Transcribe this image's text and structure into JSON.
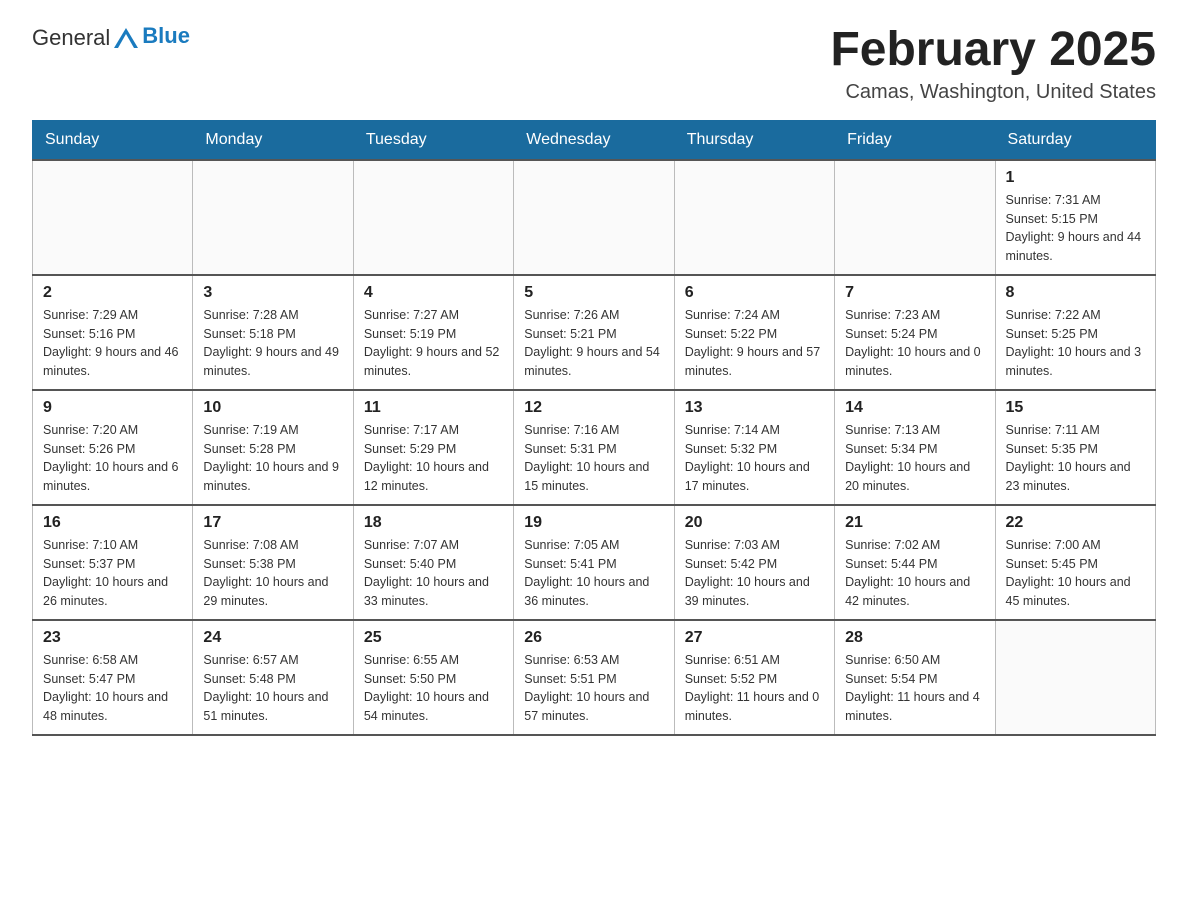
{
  "header": {
    "logo_general": "General",
    "logo_blue": "Blue",
    "month_year": "February 2025",
    "location": "Camas, Washington, United States"
  },
  "days_of_week": [
    "Sunday",
    "Monday",
    "Tuesday",
    "Wednesday",
    "Thursday",
    "Friday",
    "Saturday"
  ],
  "weeks": [
    [
      {
        "day": "",
        "info": ""
      },
      {
        "day": "",
        "info": ""
      },
      {
        "day": "",
        "info": ""
      },
      {
        "day": "",
        "info": ""
      },
      {
        "day": "",
        "info": ""
      },
      {
        "day": "",
        "info": ""
      },
      {
        "day": "1",
        "info": "Sunrise: 7:31 AM\nSunset: 5:15 PM\nDaylight: 9 hours and 44 minutes."
      }
    ],
    [
      {
        "day": "2",
        "info": "Sunrise: 7:29 AM\nSunset: 5:16 PM\nDaylight: 9 hours and 46 minutes."
      },
      {
        "day": "3",
        "info": "Sunrise: 7:28 AM\nSunset: 5:18 PM\nDaylight: 9 hours and 49 minutes."
      },
      {
        "day": "4",
        "info": "Sunrise: 7:27 AM\nSunset: 5:19 PM\nDaylight: 9 hours and 52 minutes."
      },
      {
        "day": "5",
        "info": "Sunrise: 7:26 AM\nSunset: 5:21 PM\nDaylight: 9 hours and 54 minutes."
      },
      {
        "day": "6",
        "info": "Sunrise: 7:24 AM\nSunset: 5:22 PM\nDaylight: 9 hours and 57 minutes."
      },
      {
        "day": "7",
        "info": "Sunrise: 7:23 AM\nSunset: 5:24 PM\nDaylight: 10 hours and 0 minutes."
      },
      {
        "day": "8",
        "info": "Sunrise: 7:22 AM\nSunset: 5:25 PM\nDaylight: 10 hours and 3 minutes."
      }
    ],
    [
      {
        "day": "9",
        "info": "Sunrise: 7:20 AM\nSunset: 5:26 PM\nDaylight: 10 hours and 6 minutes."
      },
      {
        "day": "10",
        "info": "Sunrise: 7:19 AM\nSunset: 5:28 PM\nDaylight: 10 hours and 9 minutes."
      },
      {
        "day": "11",
        "info": "Sunrise: 7:17 AM\nSunset: 5:29 PM\nDaylight: 10 hours and 12 minutes."
      },
      {
        "day": "12",
        "info": "Sunrise: 7:16 AM\nSunset: 5:31 PM\nDaylight: 10 hours and 15 minutes."
      },
      {
        "day": "13",
        "info": "Sunrise: 7:14 AM\nSunset: 5:32 PM\nDaylight: 10 hours and 17 minutes."
      },
      {
        "day": "14",
        "info": "Sunrise: 7:13 AM\nSunset: 5:34 PM\nDaylight: 10 hours and 20 minutes."
      },
      {
        "day": "15",
        "info": "Sunrise: 7:11 AM\nSunset: 5:35 PM\nDaylight: 10 hours and 23 minutes."
      }
    ],
    [
      {
        "day": "16",
        "info": "Sunrise: 7:10 AM\nSunset: 5:37 PM\nDaylight: 10 hours and 26 minutes."
      },
      {
        "day": "17",
        "info": "Sunrise: 7:08 AM\nSunset: 5:38 PM\nDaylight: 10 hours and 29 minutes."
      },
      {
        "day": "18",
        "info": "Sunrise: 7:07 AM\nSunset: 5:40 PM\nDaylight: 10 hours and 33 minutes."
      },
      {
        "day": "19",
        "info": "Sunrise: 7:05 AM\nSunset: 5:41 PM\nDaylight: 10 hours and 36 minutes."
      },
      {
        "day": "20",
        "info": "Sunrise: 7:03 AM\nSunset: 5:42 PM\nDaylight: 10 hours and 39 minutes."
      },
      {
        "day": "21",
        "info": "Sunrise: 7:02 AM\nSunset: 5:44 PM\nDaylight: 10 hours and 42 minutes."
      },
      {
        "day": "22",
        "info": "Sunrise: 7:00 AM\nSunset: 5:45 PM\nDaylight: 10 hours and 45 minutes."
      }
    ],
    [
      {
        "day": "23",
        "info": "Sunrise: 6:58 AM\nSunset: 5:47 PM\nDaylight: 10 hours and 48 minutes."
      },
      {
        "day": "24",
        "info": "Sunrise: 6:57 AM\nSunset: 5:48 PM\nDaylight: 10 hours and 51 minutes."
      },
      {
        "day": "25",
        "info": "Sunrise: 6:55 AM\nSunset: 5:50 PM\nDaylight: 10 hours and 54 minutes."
      },
      {
        "day": "26",
        "info": "Sunrise: 6:53 AM\nSunset: 5:51 PM\nDaylight: 10 hours and 57 minutes."
      },
      {
        "day": "27",
        "info": "Sunrise: 6:51 AM\nSunset: 5:52 PM\nDaylight: 11 hours and 0 minutes."
      },
      {
        "day": "28",
        "info": "Sunrise: 6:50 AM\nSunset: 5:54 PM\nDaylight: 11 hours and 4 minutes."
      },
      {
        "day": "",
        "info": ""
      }
    ]
  ]
}
